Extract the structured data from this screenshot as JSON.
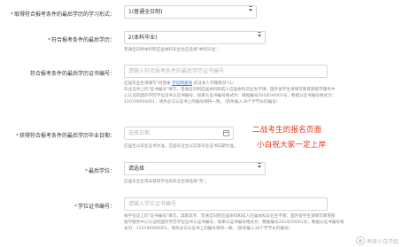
{
  "fields": {
    "study_mode": {
      "label": "取得符合报考条件的最后学历的学习形式：",
      "value": "1(普通全日制)"
    },
    "highest_degree": {
      "label": "符合报考条件的最后学历：",
      "value": "2(本科毕业)",
      "help": "普通全日制本科和应届本科毕业生应选择\"本科毕业\"。"
    },
    "certificate_no": {
      "label": "符合报考条件的最后学历证书编号：",
      "placeholder": "请输入符合报考条件的最后学历证书编号",
      "help_lines": [
        "应届毕业生请填写\"何登录 学信网查询 验证本人学籍情况\"(1)",
        "毕业证书上的\"证书编号\"填写，普通全日制应届本科和成人应届本科毕业生不填；国外留学生请填写教育部留学服务中",
        "心认证的国外学历学位证书认证书编号，如果认证书编号格式为：数据编号2010[00001号，数据认证书编号格式为：",
        "120190000001，请务必与认证书上的编号保持一致。（新条编入30个字节长的编号）"
      ],
      "help_link": "学信网查询"
    },
    "grad_date": {
      "label": "获得符合报考条件的最后学历毕业日期：",
      "placeholder": "选择日期",
      "help": "应届生以毕业证书为准，应届毕业生以实际毕业证书日期为准。"
    },
    "last_degree": {
      "label": "最后学位：",
      "value": "请选择",
      "help": "应届毕业生或未获得学位的毕业生请选择\"无\"。"
    },
    "degree_cert_no": {
      "label": "学位证书编号：",
      "placeholder": "请输入学位证书编号",
      "help_lines": [
        "按学位证上的\"证书编号\"填写。高职高专、普通全日制应届本科和成人应届本科毕业生不填；国外留学生请填写教育部",
        "留学服务中心认证的国外学历学位证书认证书编号，如果认证书编号格式为：数据编号2010[00001号，数据认证书编号格",
        "式为：120190000001，请务必与认证书上的编号保持一致。（新条编入30个字节长的编号）"
      ]
    }
  },
  "annotations": {
    "line1": "二战考生的报名页面",
    "line2": "小白祝大家一定上岸"
  },
  "watermark": "考研小白学姐",
  "colors": {
    "required": "#e3301f",
    "annotation": "#e8331a",
    "link": "#2e7cd6"
  }
}
